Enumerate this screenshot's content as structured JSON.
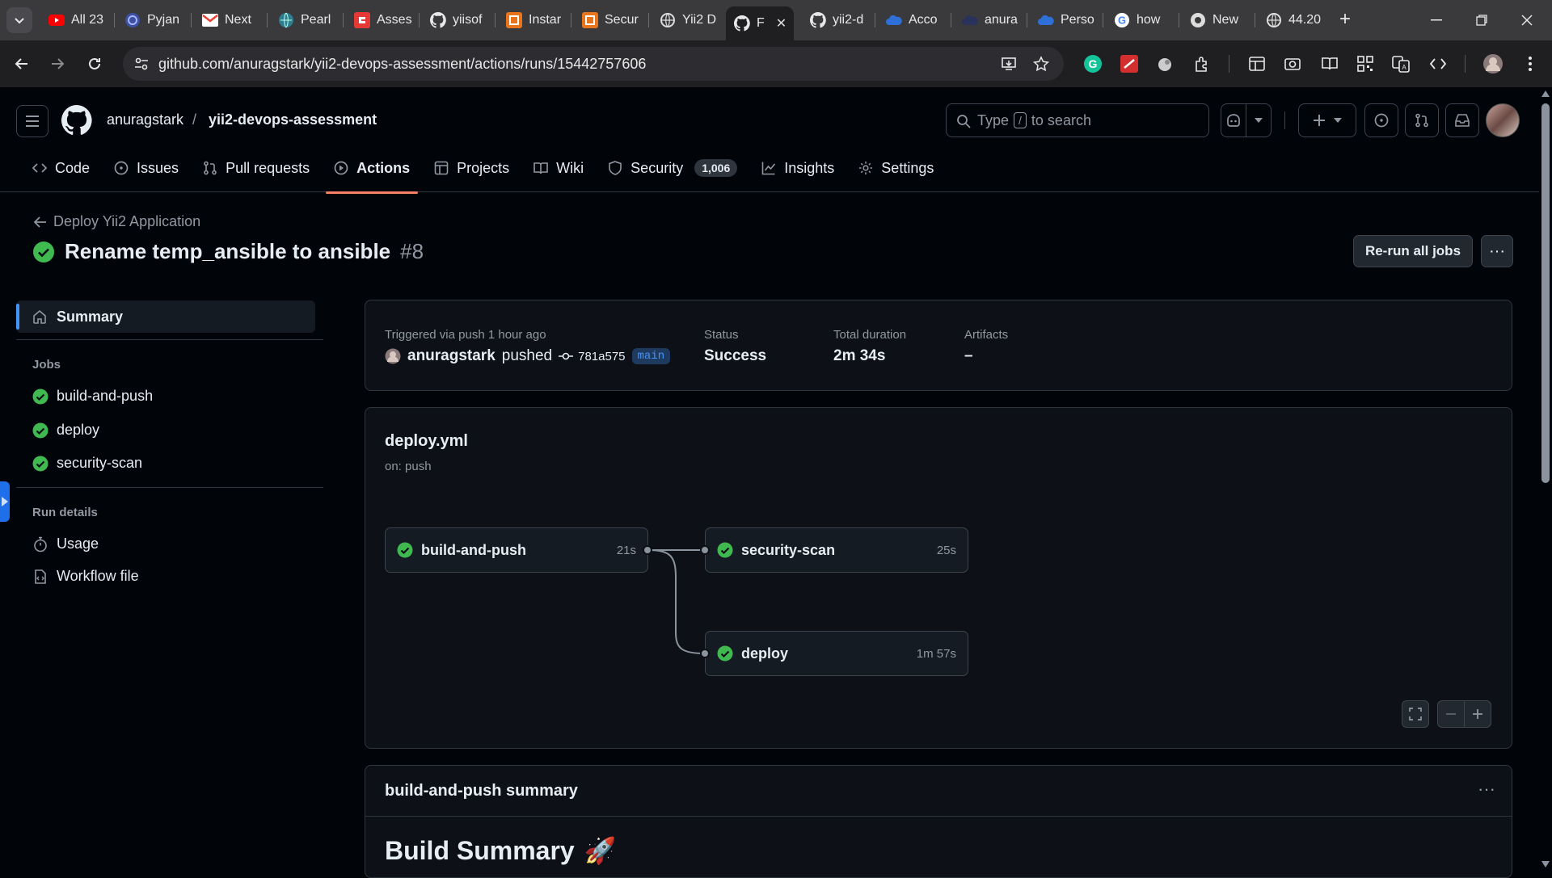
{
  "browser": {
    "tabs": [
      {
        "label": "All 23",
        "icon": "youtube-icon"
      },
      {
        "label": "Pyjan",
        "icon": "pyjama-icon"
      },
      {
        "label": "Next",
        "icon": "gmail-icon"
      },
      {
        "label": "Pearl",
        "icon": "globe-icon"
      },
      {
        "label": "Asses",
        "icon": "assessment-icon"
      },
      {
        "label": "yiisof",
        "icon": "github-icon"
      },
      {
        "label": "Instar",
        "icon": "aws-icon"
      },
      {
        "label": "Secur",
        "icon": "aws-icon"
      },
      {
        "label": "Yii2 D",
        "icon": "globe-icon"
      },
      {
        "label": "F",
        "icon": "github-icon",
        "active": true
      },
      {
        "label": "yii2-d",
        "icon": "github-icon"
      },
      {
        "label": "Acco",
        "icon": "cloud-icon"
      },
      {
        "label": "anura",
        "icon": "cloud-icon"
      },
      {
        "label": "Perso",
        "icon": "cloud-icon"
      },
      {
        "label": "how",
        "icon": "google-icon"
      },
      {
        "label": "New",
        "icon": "chrome-icon"
      },
      {
        "label": "44.20",
        "icon": "globe-icon"
      }
    ],
    "url": "github.com/anuragstark/yii2-devops-assessment/actions/runs/15442757606",
    "colors": {
      "tabbar": "#3a3a3d",
      "toolbar": "#1f1f22"
    }
  },
  "header": {
    "owner": "anuragstark",
    "separator": "/",
    "repo": "yii2-devops-assessment",
    "search_prefix": "Type",
    "search_key": "/",
    "search_suffix": "to search"
  },
  "repo_nav": [
    {
      "label": "Code",
      "icon": "code-icon"
    },
    {
      "label": "Issues",
      "icon": "issue-icon"
    },
    {
      "label": "Pull requests",
      "icon": "pull-request-icon"
    },
    {
      "label": "Actions",
      "icon": "play-icon",
      "active": true
    },
    {
      "label": "Projects",
      "icon": "table-icon"
    },
    {
      "label": "Wiki",
      "icon": "book-icon"
    },
    {
      "label": "Security",
      "icon": "shield-icon",
      "counter": "1,006"
    },
    {
      "label": "Insights",
      "icon": "graph-icon"
    },
    {
      "label": "Settings",
      "icon": "gear-icon"
    }
  ],
  "run": {
    "workflow_name": "Deploy Yii2 Application",
    "title": "Rename temp_ansible to ansible",
    "number": "#8",
    "rerun_label": "Re-run all jobs",
    "more_label": "···"
  },
  "sidebar": {
    "summary_label": "Summary",
    "jobs_heading": "Jobs",
    "jobs": [
      "build-and-push",
      "deploy",
      "security-scan"
    ],
    "details_heading": "Run details",
    "details": [
      {
        "label": "Usage",
        "icon": "stopwatch-icon"
      },
      {
        "label": "Workflow file",
        "icon": "file-icon"
      }
    ]
  },
  "meta": {
    "trigger_label": "Triggered via push 1 hour ago",
    "actor": "anuragstark",
    "action": "pushed",
    "commit": "781a575",
    "branch": "main",
    "status_label": "Status",
    "status_value": "Success",
    "duration_label": "Total duration",
    "duration_value": "2m 34s",
    "artifacts_label": "Artifacts",
    "artifacts_value": "–"
  },
  "workflow": {
    "file": "deploy.yml",
    "trigger": "on: push",
    "jobs": [
      {
        "name": "build-and-push",
        "duration": "21s",
        "status": "success"
      },
      {
        "name": "security-scan",
        "duration": "25s",
        "status": "success"
      },
      {
        "name": "deploy",
        "duration": "1m 57s",
        "status": "success"
      }
    ],
    "zoom_controls": [
      "fullscreen-icon",
      "zoom-out-icon",
      "zoom-in-icon"
    ]
  },
  "summary": {
    "title": "build-and-push summary",
    "heading": "Build Summary",
    "heading_emoji": "🚀"
  },
  "colors": {
    "success": "#3fb950",
    "accent": "#f78166",
    "link": "#4493f8",
    "bg": "#010409",
    "card": "#0d1117"
  }
}
